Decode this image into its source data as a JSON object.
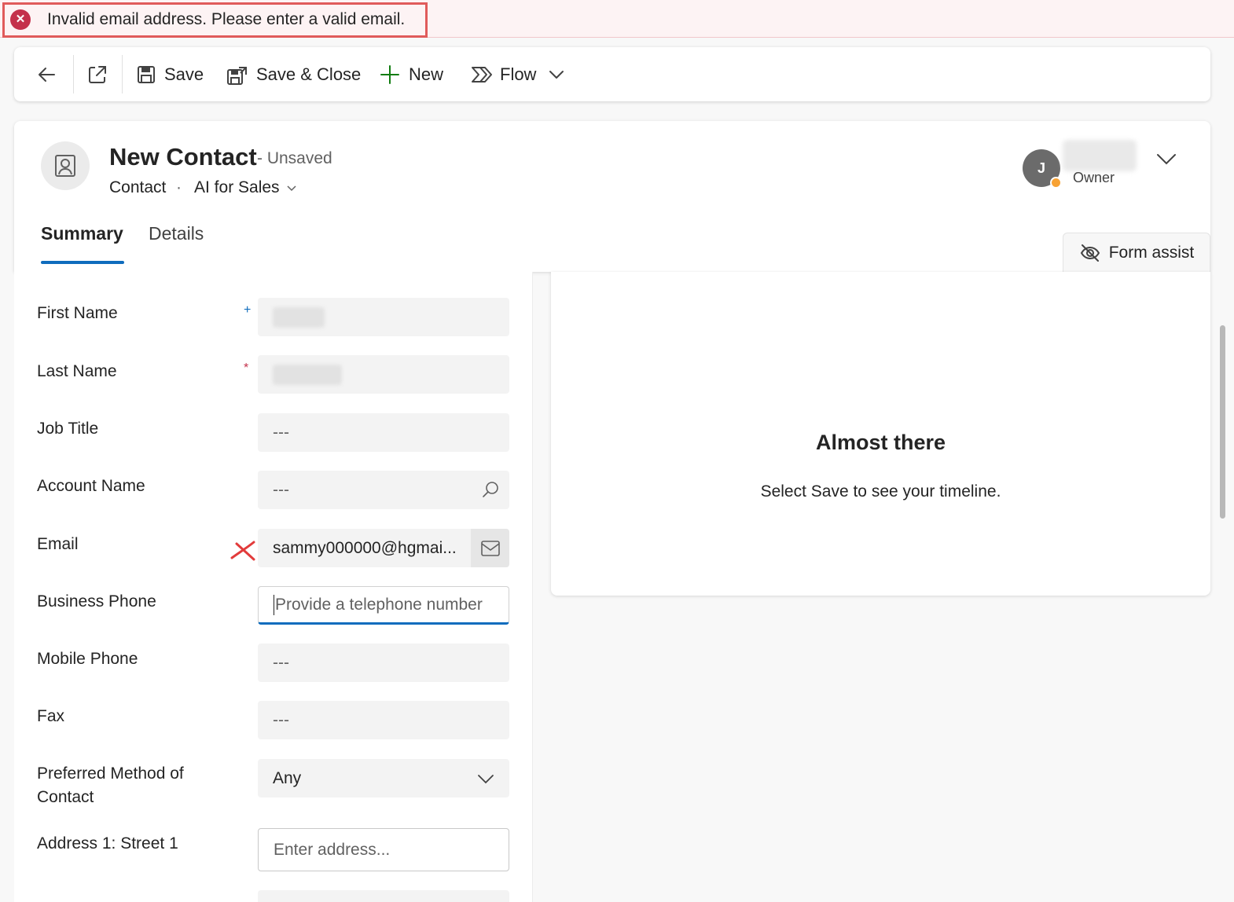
{
  "notification": {
    "message": "Invalid email address. Please enter a valid email.",
    "icon": "error-circle-icon",
    "color": "#c4314b"
  },
  "commandbar": {
    "save_label": "Save",
    "save_close_label": "Save & Close",
    "new_label": "New",
    "flow_label": "Flow"
  },
  "header": {
    "title": "New Contact",
    "status": "- Unsaved",
    "entity": "Contact",
    "separator": "·",
    "app": "AI for Sales",
    "owner_initial": "J",
    "owner_label": "Owner",
    "tabs": [
      {
        "label": "Summary",
        "selected": true
      },
      {
        "label": "Details",
        "selected": false
      }
    ],
    "form_assist_label": "Form assist"
  },
  "form": {
    "first_name_label": "First Name",
    "last_name_label": "Last Name",
    "job_title_label": "Job Title",
    "job_title_value": "---",
    "account_name_label": "Account Name",
    "account_name_value": "---",
    "email_label": "Email",
    "email_value": "sammy000000@hgmai...",
    "business_phone_label": "Business Phone",
    "business_phone_placeholder": "Provide a telephone number",
    "mobile_phone_label": "Mobile Phone",
    "mobile_phone_value": "---",
    "fax_label": "Fax",
    "fax_value": "---",
    "preferred_contact_label_1": "Preferred Method of",
    "preferred_contact_label_2": "Contact",
    "preferred_contact_value": "Any",
    "address_street1_label": "Address 1: Street 1",
    "address_street1_placeholder": "Enter address..."
  },
  "timeline": {
    "title": "Almost there",
    "subtitle": "Select Save to see your timeline."
  },
  "colors": {
    "accent": "#0f6cbd",
    "error": "#c4314b",
    "new_plus": "#107c10"
  }
}
